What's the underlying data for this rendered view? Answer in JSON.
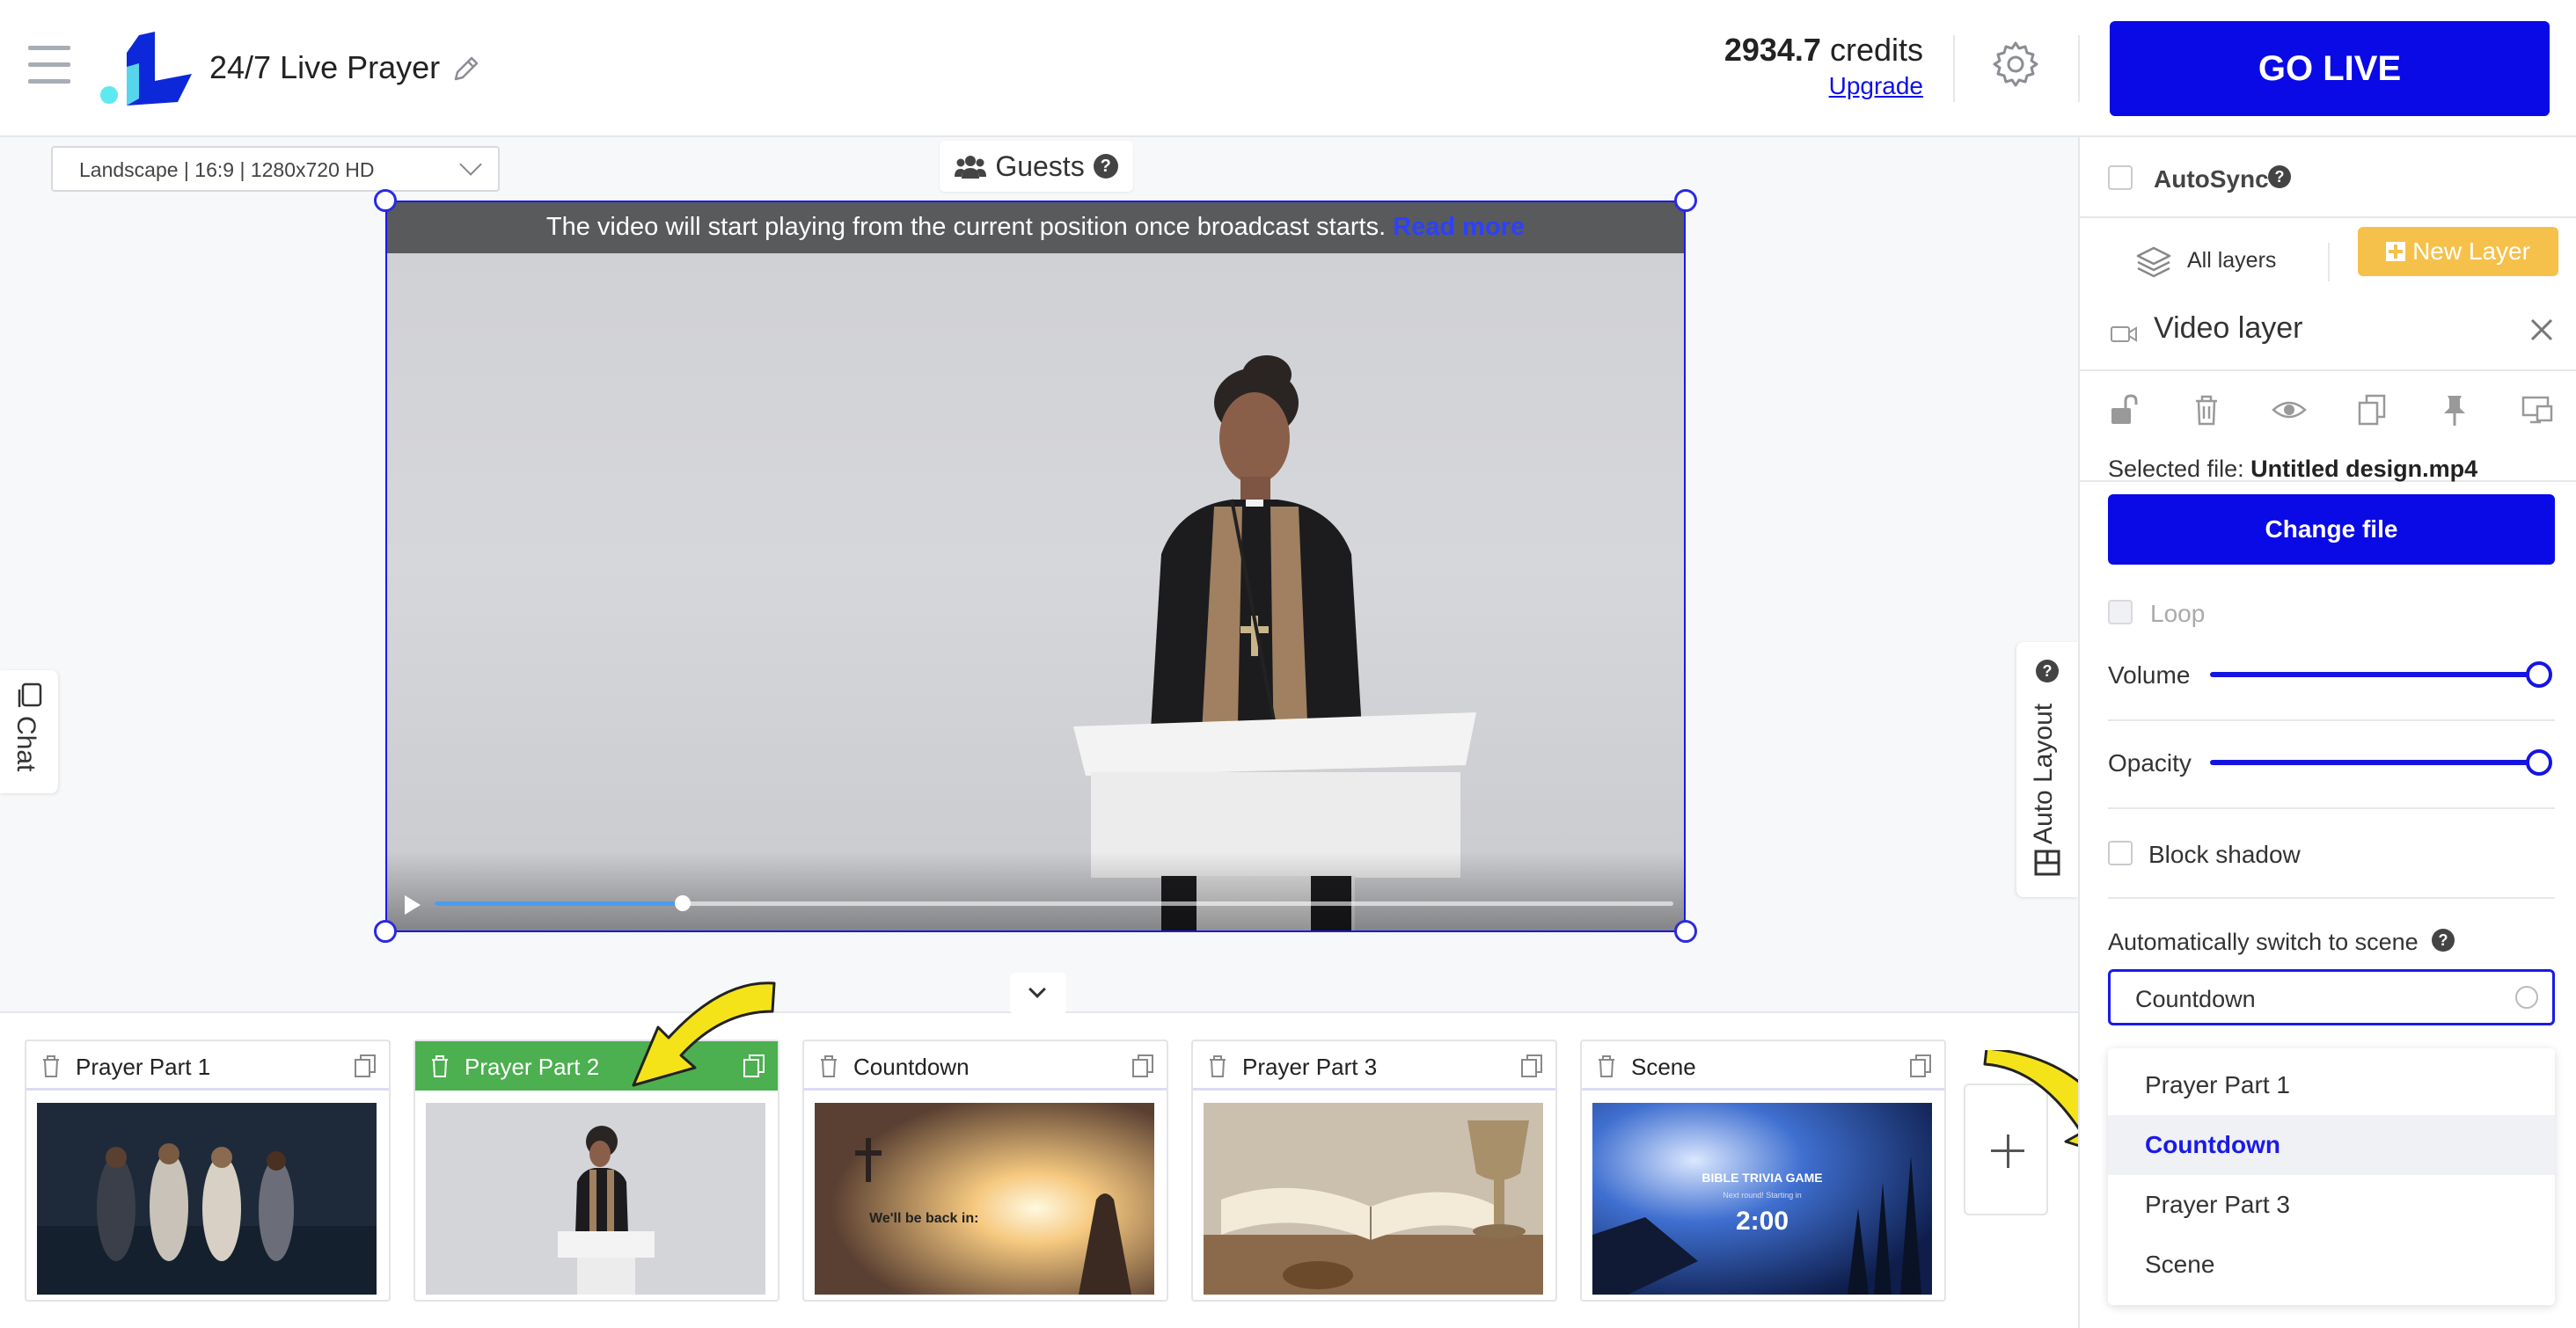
{
  "header": {
    "app_title": "24/7 Live Prayer",
    "credits_value": "2934.7",
    "credits_label": "credits",
    "upgrade_label": "Upgrade",
    "go_live_label": "GO LIVE"
  },
  "canvas": {
    "resolution": "Landscape | 16:9 | 1280x720 HD",
    "guests_label": "Guests",
    "notice_text": "The video will start playing from the current position once broadcast starts.",
    "notice_link": "Read more",
    "playback_progress": 0.2,
    "chat_label": "Chat",
    "auto_layout_label": "Auto Layout"
  },
  "scenes": [
    {
      "name": "Prayer Part 1",
      "active": false
    },
    {
      "name": "Prayer Part 2",
      "active": true
    },
    {
      "name": "Countdown",
      "active": false
    },
    {
      "name": "Prayer Part 3",
      "active": false
    },
    {
      "name": "Scene",
      "active": false
    }
  ],
  "thumbs": {
    "countdown_text": "We'll be back in:",
    "scene_title": "BIBLE TRIVIA GAME",
    "scene_subtitle": "Next round! Starting in",
    "scene_time": "2:00"
  },
  "panel": {
    "autosync_label": "AutoSync",
    "all_layers_label": "All layers",
    "new_layer_label": "New Layer",
    "video_layer_title": "Video layer",
    "selected_file_label": "Selected file:",
    "selected_file_name": "Untitled design.mp4",
    "change_file_label": "Change file",
    "loop_label": "Loop",
    "volume_label": "Volume",
    "volume_value": 1.0,
    "opacity_label": "Opacity",
    "opacity_value": 1.0,
    "block_shadow_label": "Block shadow",
    "auto_switch_label": "Automatically switch to scene",
    "auto_switch_value": "Countdown",
    "dropdown_options": [
      "Prayer Part 1",
      "Countdown",
      "Prayer Part 3",
      "Scene"
    ],
    "dropdown_selected": "Countdown"
  },
  "colors": {
    "primary": "#0a0ae6",
    "active_scene": "#4caf50",
    "new_layer": "#f5c14a",
    "arrow": "#f5e31a"
  }
}
